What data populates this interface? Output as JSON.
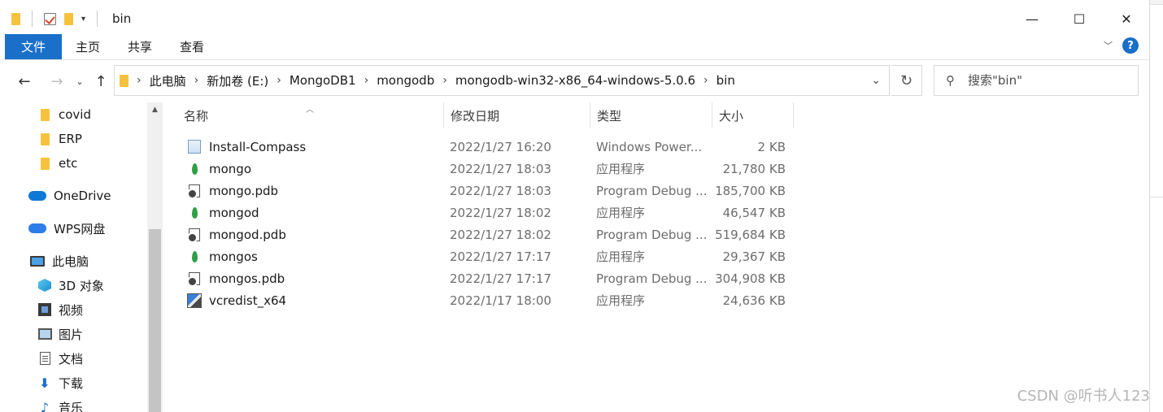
{
  "window": {
    "title": "bin",
    "controls": {
      "minimize": "—",
      "maximize": "☐",
      "close": "✕"
    }
  },
  "ribbon": {
    "tabs": [
      "文件",
      "主页",
      "共享",
      "查看"
    ],
    "help": "?"
  },
  "address": {
    "crumbs": [
      "此电脑",
      "新加卷 (E:)",
      "MongoDB1",
      "mongodb",
      "mongodb-win32-x86_64-windows-5.0.6",
      "bin"
    ]
  },
  "search": {
    "placeholder": "搜索\"bin\""
  },
  "nav_pane": {
    "items": [
      {
        "label": "covid",
        "icon": "folder-icon"
      },
      {
        "label": "ERP",
        "icon": "folder-icon"
      },
      {
        "label": "etc",
        "icon": "folder-icon"
      },
      {
        "label": "OneDrive",
        "icon": "onedrive-icon"
      },
      {
        "label": "WPS网盘",
        "icon": "wps-cloud-icon"
      },
      {
        "label": "此电脑",
        "icon": "computer-icon"
      },
      {
        "label": "3D 对象",
        "icon": "3d-objects-icon"
      },
      {
        "label": "视频",
        "icon": "video-icon"
      },
      {
        "label": "图片",
        "icon": "pictures-icon"
      },
      {
        "label": "文档",
        "icon": "documents-icon"
      },
      {
        "label": "下载",
        "icon": "download-icon"
      },
      {
        "label": "音乐",
        "icon": "music-icon"
      }
    ]
  },
  "file_list": {
    "columns": [
      "名称",
      "修改日期",
      "类型",
      "大小"
    ],
    "rows": [
      {
        "name": "Install-Compass",
        "date": "2022/1/27 16:20",
        "type": "Windows Power...",
        "size": "2 KB",
        "icon": "powershell-script-icon"
      },
      {
        "name": "mongo",
        "date": "2022/1/27 18:03",
        "type": "应用程序",
        "size": "21,780 KB",
        "icon": "mongodb-leaf-icon"
      },
      {
        "name": "mongo.pdb",
        "date": "2022/1/27 18:03",
        "type": "Program Debug ...",
        "size": "185,700 KB",
        "icon": "pdb-file-icon"
      },
      {
        "name": "mongod",
        "date": "2022/1/27 18:02",
        "type": "应用程序",
        "size": "46,547 KB",
        "icon": "mongodb-leaf-icon"
      },
      {
        "name": "mongod.pdb",
        "date": "2022/1/27 18:02",
        "type": "Program Debug ...",
        "size": "519,684 KB",
        "icon": "pdb-file-icon"
      },
      {
        "name": "mongos",
        "date": "2022/1/27 17:17",
        "type": "应用程序",
        "size": "29,367 KB",
        "icon": "mongodb-leaf-icon"
      },
      {
        "name": "mongos.pdb",
        "date": "2022/1/27 17:17",
        "type": "Program Debug ...",
        "size": "304,908 KB",
        "icon": "pdb-file-icon"
      },
      {
        "name": "vcredist_x64",
        "date": "2022/1/17 18:00",
        "type": "应用程序",
        "size": "24,636 KB",
        "icon": "installer-icon"
      }
    ]
  },
  "watermark": "CSDN @听书人123",
  "colors": {
    "accent": "#1a6fc9",
    "leaf": "#2f9e44",
    "folder": "#f6c23e"
  }
}
